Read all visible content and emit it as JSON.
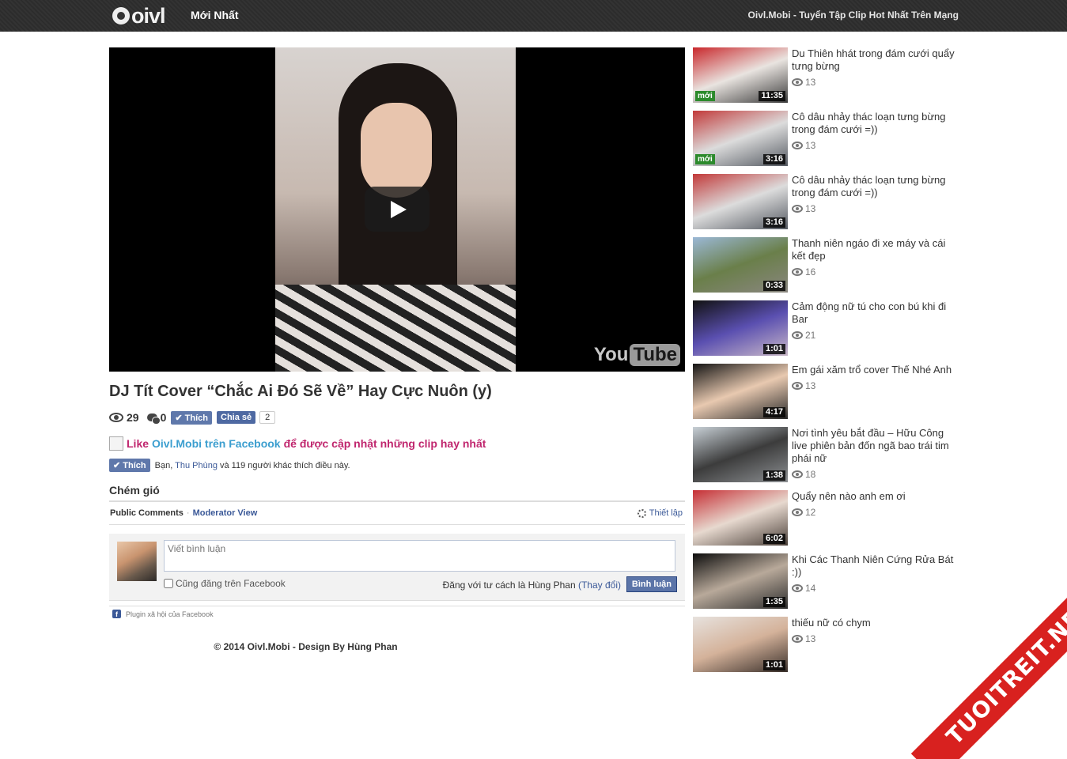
{
  "header": {
    "logo_text": "oivl",
    "nav_latest": "Mới Nhất",
    "tagline": "Oivl.Mobi - Tuyển Tập Clip Hot Nhất Trên Mạng"
  },
  "player": {
    "brand_left": "You",
    "brand_right": "Tube"
  },
  "video": {
    "title": "DJ Tít Cover “Chắc Ai Đó Sẽ Về” Hay Cực Nuôn (y)",
    "views": "29",
    "comments": "0",
    "like_label": "Thích",
    "share_label": "Chia sẻ",
    "share_count": "2"
  },
  "fb_promo": {
    "like_word": "Like",
    "page_link": "Oivl.Mobi trên Facebook",
    "suffix": "để được cập nhật những clip hay nhất",
    "like_button": "Thích",
    "likers_prefix": "Bạn, ",
    "likers_name": "Thu Phùng",
    "likers_suffix": " và 119 người khác thích điều này."
  },
  "comments": {
    "heading": "Chém gió",
    "tab_public": "Public Comments",
    "tab_separator": "·",
    "tab_moderator": "Moderator View",
    "settings": "Thiết lập",
    "placeholder": "Viết bình luận",
    "also_post": "Cũng đăng trên Facebook",
    "posting_as": "Đăng với tư cách là Hùng Phan ",
    "change": "(Thay đổi)",
    "submit": "Bình luận",
    "plugin": "Plugin xã hội của Facebook"
  },
  "footer": "© 2014 Oivl.Mobi - Design By Hùng Phan",
  "sidebar": [
    {
      "title": "Du Thiên hhát trong đám cưới quẩy tưng bừng",
      "views": "13",
      "duration": "11:35",
      "badge": "mới",
      "colors": [
        "#c9282c",
        "#e9e4e0",
        "#3a3a3a"
      ]
    },
    {
      "title": "Cô dâu nhảy thác loạn tưng bừng trong đám cưới =))",
      "views": "13",
      "duration": "3:16",
      "badge": "mới",
      "colors": [
        "#c23a3a",
        "#dcdcdc",
        "#555a62"
      ]
    },
    {
      "title": "Cô dâu nhảy thác loạn tưng bừng trong đám cưới =))",
      "views": "13",
      "duration": "3:16",
      "badge": "",
      "colors": [
        "#c23a3a",
        "#dcdcdc",
        "#555a62"
      ]
    },
    {
      "title": "Thanh niên ngáo đi xe máy và cái kết đẹp",
      "views": "16",
      "duration": "0:33",
      "badge": "",
      "colors": [
        "#9bb8d6",
        "#6a7f4a",
        "#8a8680"
      ]
    },
    {
      "title": "Cảm động nữ tú cho con bú khi đi Bar",
      "views": "21",
      "duration": "1:01",
      "badge": "",
      "colors": [
        "#111111",
        "#5a4fb0",
        "#c9b8c8"
      ]
    },
    {
      "title": "Em gái xăm trổ cover Thế Nhé Anh",
      "views": "13",
      "duration": "4:17",
      "badge": "",
      "colors": [
        "#141414",
        "#e8c9b0",
        "#2a2a2a"
      ]
    },
    {
      "title": "Nơi tình yêu bắt đầu – Hữu Công live phiên bản đốn ngã bao trái tim phái nữ",
      "views": "18",
      "duration": "1:38",
      "badge": "",
      "colors": [
        "#c8d0d6",
        "#3c3c3c",
        "#8c8f92"
      ]
    },
    {
      "title": "Quẩy nên nào anh em ơi",
      "views": "12",
      "duration": "6:02",
      "badge": "",
      "colors": [
        "#c62f35",
        "#e7d9cf",
        "#4a3f38"
      ]
    },
    {
      "title": "Khi Các Thanh Niên Cứng Rửa Bát :))",
      "views": "14",
      "duration": "1:35",
      "badge": "",
      "colors": [
        "#0d0d0d",
        "#b8a99a",
        "#2c2c2c"
      ]
    },
    {
      "title": "thiếu nữ có chym",
      "views": "13",
      "duration": "1:01",
      "badge": "",
      "colors": [
        "#e7e2de",
        "#d4b29a",
        "#3a302b"
      ]
    }
  ],
  "watermark": "TUOITREIT.NET"
}
